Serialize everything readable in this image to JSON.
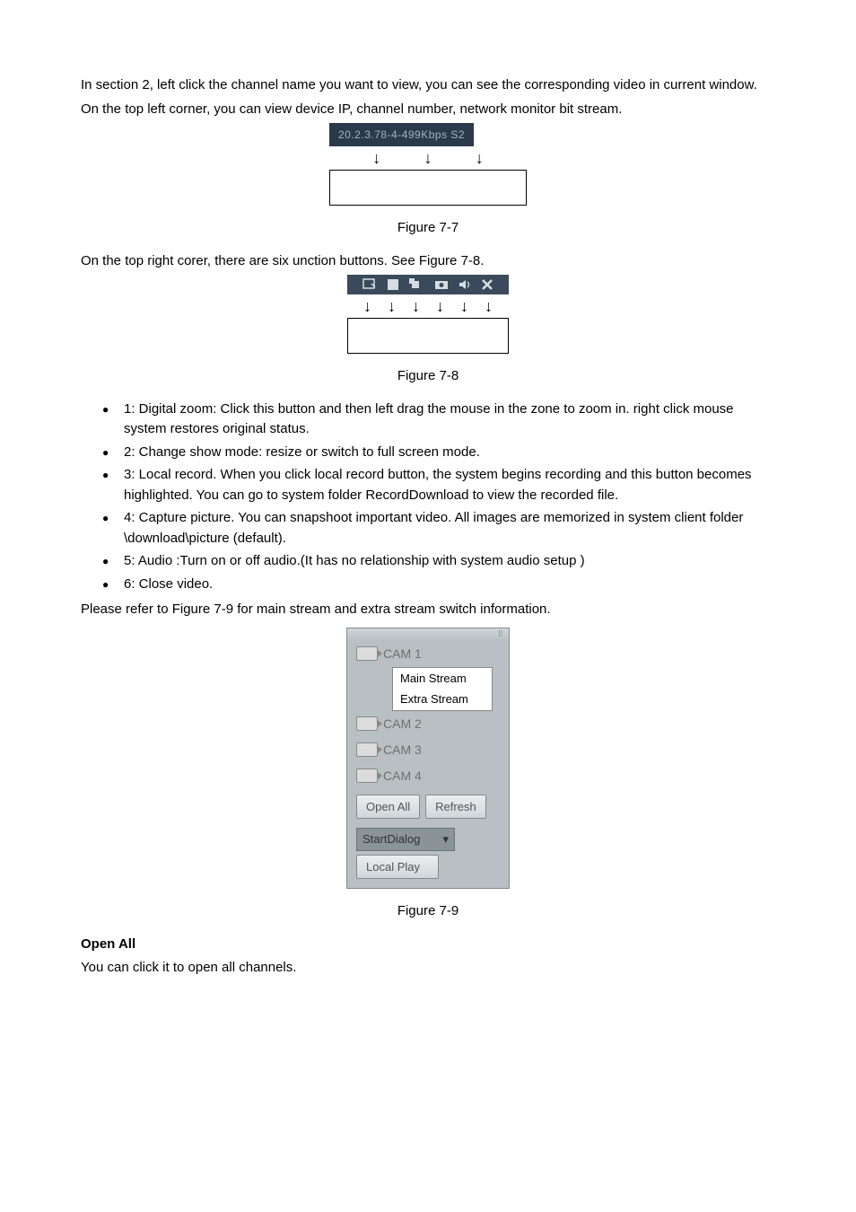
{
  "para1": " In section 2, left click the channel name you want to view, you can see the corresponding video in current window.",
  "para2": "On the top left corner, you can view device IP, channel number, network monitor bit stream.",
  "fig77_banner": "20.2.3.78-4-499Kbps S2",
  "fig77_caption": "Figure 7-7",
  "para3": "On the top right corer, there are six unction buttons. See Figure 7-8.",
  "fig78_caption": "Figure 7-8",
  "bullets": [
    "1: Digital zoom: Click this button and then left drag the mouse in the zone to zoom in. right click mouse system restores original status.",
    "2: Change show mode: resize or switch to full screen mode.",
    "3: Local record. When you click local record button, the system begins recording and this button becomes highlighted. You can go to system folder RecordDownload to view the recorded file.",
    "4: Capture picture. You can snapshoot important video. All images are memorized in system client folder \\download\\picture (default).",
    "5: Audio :Turn on or off audio.(It has no relationship with system audio setup )",
    "6: Close video."
  ],
  "para4": "Please refer to Figure 7-9 for main stream and extra stream switch information.",
  "panel": {
    "cams": [
      "CAM 1",
      "CAM 2",
      "CAM 3",
      "CAM 4"
    ],
    "context": [
      "Main Stream",
      "Extra Stream"
    ],
    "open_all": "Open All",
    "refresh": "Refresh",
    "start_dialog": "StartDialog",
    "local_play": "Local Play"
  },
  "fig79_caption": "Figure 7-9",
  "open_all_hd": "Open All",
  "open_all_desc": "You can click it to open all channels."
}
